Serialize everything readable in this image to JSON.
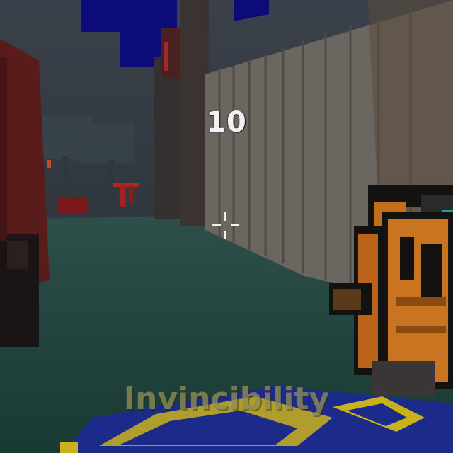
{
  "hud": {
    "countdown": "10",
    "powerup_label": "Invincibility"
  },
  "icons": {
    "crosshair": "crosshair-icon"
  },
  "colors": {
    "sky": "#0d0d7a",
    "fog": "#2e3640",
    "grass": "#1f4a42",
    "fence": "#6f6a63",
    "gun_orange": "#c26f1c",
    "gun_black": "#141210",
    "pickup_blue": "#1f2a8f",
    "pickup_yellow": "#c9b21c",
    "hud_text": "#f2f2f2",
    "powerup_text": "#8f8d54"
  }
}
